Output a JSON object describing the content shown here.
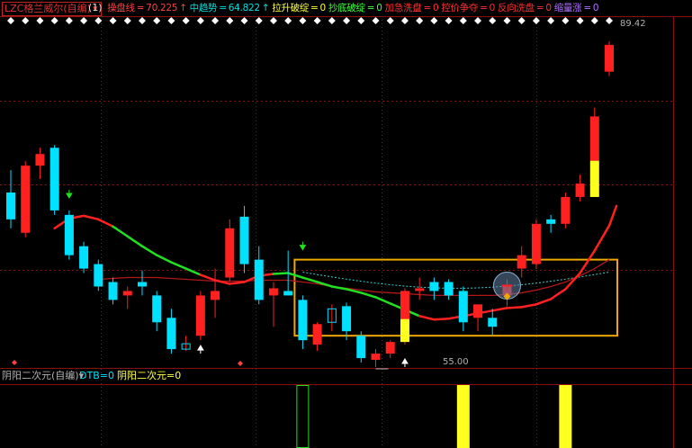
{
  "main_header": {
    "title": "LZC格兰威尔(自编)",
    "period": "(1)",
    "indicators": [
      {
        "label": "操盘线",
        "value": "70.225",
        "arrow": "↑",
        "color": "#ff4040"
      },
      {
        "label": "中趋势",
        "value": "64.822",
        "arrow": "↑",
        "color": "#00e0e0"
      },
      {
        "label": "拉升破绽",
        "value": "0",
        "arrow": "",
        "color": "#ffff40"
      },
      {
        "label": "抄底破绽",
        "value": "0",
        "arrow": "",
        "color": "#40ff40"
      },
      {
        "label": "加急洗盘",
        "value": "0",
        "arrow": "",
        "color": "#ff3030"
      },
      {
        "label": "控价争夺",
        "value": "0",
        "arrow": "",
        "color": "#ff3030"
      },
      {
        "label": "反向洗盘",
        "value": "0",
        "arrow": "",
        "color": "#ff3030"
      },
      {
        "label": "缩量涨",
        "value": "0",
        "arrow": "",
        "color": "#b070ff"
      }
    ]
  },
  "sub_header": {
    "title": "阴阳二次元(自编)",
    "indicators": [
      {
        "label": "DTB",
        "value": "0",
        "color": "#00e0ff"
      },
      {
        "label": "阴阳二次元",
        "value": "0",
        "color": "#ffff40"
      }
    ]
  },
  "price_labels": {
    "high": "89.42",
    "low": "55.00"
  },
  "colors": {
    "up": "#ff2020",
    "down": "#00e0ff",
    "yellow": "#ffff20",
    "green": "#20e020",
    "box": "#f0a800",
    "bg": "#000000"
  },
  "chart_data": {
    "type": "candlestick",
    "ylim": [
      53,
      92
    ],
    "candles": [
      {
        "o": 72.5,
        "h": 75.0,
        "l": 68.5,
        "c": 69.5
      },
      {
        "o": 68.0,
        "h": 76.0,
        "l": 67.5,
        "c": 75.5
      },
      {
        "o": 75.5,
        "h": 77.5,
        "l": 74.0,
        "c": 76.8
      },
      {
        "o": 77.5,
        "h": 77.8,
        "l": 70.0,
        "c": 70.5
      },
      {
        "o": 70.0,
        "h": 70.5,
        "l": 65.0,
        "c": 65.5
      },
      {
        "o": 66.5,
        "h": 67.0,
        "l": 63.5,
        "c": 64.0
      },
      {
        "o": 64.5,
        "h": 65.0,
        "l": 61.5,
        "c": 62.0
      },
      {
        "o": 62.5,
        "h": 63.0,
        "l": 60.0,
        "c": 60.5
      },
      {
        "o": 61.0,
        "h": 62.0,
        "l": 59.5,
        "c": 61.5
      },
      {
        "o": 62.5,
        "h": 63.8,
        "l": 61.0,
        "c": 62.0
      },
      {
        "o": 61.0,
        "h": 61.5,
        "l": 57.0,
        "c": 58.0
      },
      {
        "o": 58.5,
        "h": 59.5,
        "l": 54.5,
        "c": 55.0
      },
      {
        "o": 55.0,
        "h": 56.5,
        "l": 54.8,
        "c": 55.6
      },
      {
        "o": 56.5,
        "h": 61.5,
        "l": 56.0,
        "c": 61.0
      },
      {
        "o": 60.5,
        "h": 64.0,
        "l": 58.5,
        "c": 61.5
      },
      {
        "o": 63.0,
        "h": 69.5,
        "l": 62.5,
        "c": 68.5
      },
      {
        "o": 69.8,
        "h": 71.0,
        "l": 63.5,
        "c": 64.5
      },
      {
        "o": 65.0,
        "h": 66.5,
        "l": 60.0,
        "c": 60.5
      },
      {
        "o": 61.0,
        "h": 62.5,
        "l": 57.5,
        "c": 61.8
      },
      {
        "o": 61.5,
        "h": 66.0,
        "l": 61.0,
        "c": 61.0
      },
      {
        "o": 60.5,
        "h": 61.0,
        "l": 55.0,
        "c": 56.0
      },
      {
        "o": 55.5,
        "h": 58.0,
        "l": 54.8,
        "c": 57.8
      },
      {
        "o": 58.0,
        "h": 60.0,
        "l": 57.0,
        "c": 59.5
      },
      {
        "o": 59.8,
        "h": 60.2,
        "l": 56.0,
        "c": 57.0
      },
      {
        "o": 56.5,
        "h": 57.0,
        "l": 53.5,
        "c": 54.0
      },
      {
        "o": 53.8,
        "h": 55.0,
        "l": 53.0,
        "c": 54.5
      },
      {
        "o": 54.5,
        "h": 56.0,
        "l": 54.0,
        "c": 55.8
      },
      {
        "o": 55.8,
        "h": 61.8,
        "l": 55.5,
        "c": 61.5,
        "yellow": true
      },
      {
        "o": 61.5,
        "h": 63.0,
        "l": 60.5,
        "c": 61.8
      },
      {
        "o": 62.5,
        "h": 63.0,
        "l": 60.5,
        "c": 61.5
      },
      {
        "o": 62.5,
        "h": 62.8,
        "l": 60.5,
        "c": 61.0
      },
      {
        "o": 61.5,
        "h": 62.0,
        "l": 57.0,
        "c": 58.0
      },
      {
        "o": 58.5,
        "h": 60.0,
        "l": 57.0,
        "c": 60.0
      },
      {
        "o": 58.5,
        "h": 59.5,
        "l": 56.5,
        "c": 57.5
      },
      {
        "o": 61.0,
        "h": 62.8,
        "l": 59.8,
        "c": 62.2,
        "doji": true
      },
      {
        "o": 64.0,
        "h": 66.5,
        "l": 63.0,
        "c": 65.5
      },
      {
        "o": 64.5,
        "h": 69.5,
        "l": 64.0,
        "c": 69.0
      },
      {
        "o": 69.5,
        "h": 70.0,
        "l": 68.0,
        "c": 69.0
      },
      {
        "o": 69.0,
        "h": 72.5,
        "l": 68.5,
        "c": 72.0
      },
      {
        "o": 72.0,
        "h": 74.5,
        "l": 71.5,
        "c": 73.5
      },
      {
        "o": 72.0,
        "h": 82.0,
        "l": 72.0,
        "c": 81.0,
        "yellow": true
      },
      {
        "o": 86.0,
        "h": 89.4,
        "l": 85.5,
        "c": 89.0
      }
    ],
    "ma_fast": [
      null,
      null,
      null,
      68.5,
      69.6,
      69.9,
      69.5,
      68.7,
      67.6,
      66.5,
      65.5,
      64.7,
      64.0,
      63.3,
      62.7,
      62.3,
      62.5,
      63.2,
      63.4,
      63.5,
      63.0,
      62.5,
      62.0,
      61.7,
      61.3,
      60.8,
      60.1,
      59.4,
      58.7,
      58.3,
      58.4,
      58.7,
      59.0,
      59.3,
      59.6,
      59.7,
      60.0,
      60.6,
      61.7,
      63.5,
      66.0,
      68.8
    ],
    "ma_fast_green": [
      false,
      false,
      false,
      false,
      false,
      false,
      false,
      false,
      true,
      true,
      true,
      true,
      true,
      true,
      false,
      false,
      false,
      false,
      false,
      true,
      true,
      true,
      true,
      true,
      true,
      true,
      true,
      true,
      true,
      false,
      false,
      false,
      false,
      false,
      false,
      false,
      false,
      false,
      false,
      false,
      false,
      false
    ],
    "ma_slow": [
      null,
      null,
      null,
      null,
      null,
      null,
      62.8,
      62.9,
      63.0,
      63.0,
      63.0,
      62.9,
      62.8,
      62.7,
      62.6,
      62.6,
      62.6,
      62.7,
      62.7,
      62.7,
      62.5,
      62.3,
      62.0,
      61.8,
      61.6,
      61.4,
      61.3,
      61.2,
      61.1,
      61.0,
      61.0,
      61.0,
      61.0,
      61.0,
      61.1,
      61.3,
      61.6,
      62.0,
      62.5,
      63.2,
      64.0,
      65.0
    ],
    "signal_box": {
      "start": 20,
      "end": 41,
      "top": 65.0,
      "bottom": 56.5
    },
    "markers": [
      {
        "index": 4,
        "type": "down-arrow",
        "price": 72.0,
        "color": "#20e020"
      },
      {
        "index": 13,
        "type": "up-arrow",
        "price": 55.0,
        "color": "#ffffff"
      },
      {
        "index": 20,
        "type": "down-arrow",
        "price": 66.2,
        "color": "#20e020"
      },
      {
        "index": 27,
        "type": "up-arrow",
        "price": 53.5,
        "color": "#ffffff"
      }
    ],
    "sub_panel": {
      "type": "bar",
      "bars": [
        {
          "index": 20,
          "style": "outline",
          "color": "#20e020"
        },
        {
          "index": 31,
          "style": "fill",
          "color": "#ffff20"
        },
        {
          "index": 38,
          "style": "fill",
          "color": "#ffff20"
        }
      ]
    }
  }
}
